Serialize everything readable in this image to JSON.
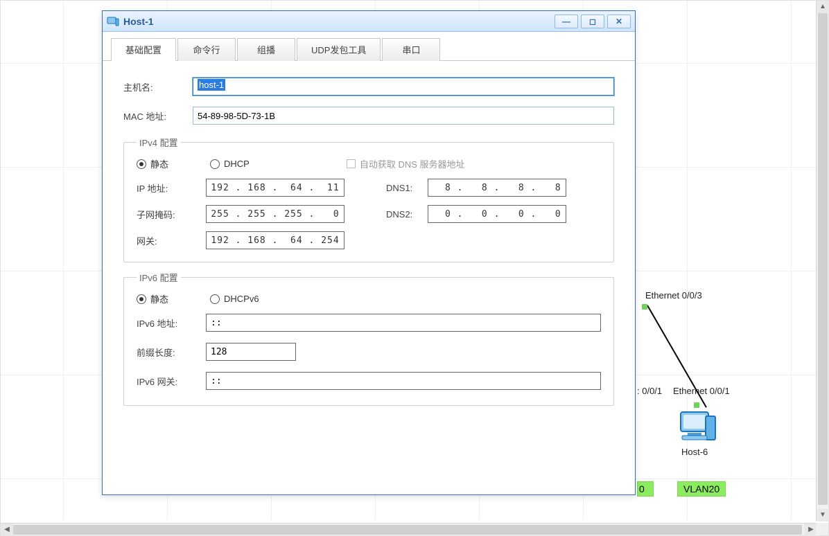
{
  "window": {
    "title": "Host-1"
  },
  "tabs": [
    {
      "label": "基础配置",
      "active": true
    },
    {
      "label": "命令行",
      "active": false
    },
    {
      "label": "组播",
      "active": false
    },
    {
      "label": "UDP发包工具",
      "active": false
    },
    {
      "label": "串口",
      "active": false
    }
  ],
  "basic": {
    "hostname_label": "主机名:",
    "hostname_value": "host-1",
    "mac_label": "MAC 地址:",
    "mac_value": "54-89-98-5D-73-1B"
  },
  "ipv4": {
    "legend": "IPv4 配置",
    "static_label": "静态",
    "dhcp_label": "DHCP",
    "auto_dns_label": "自动获取 DNS 服务器地址",
    "ip_label": "IP 地址:",
    "ip_value": "192 . 168 .  64 .  11",
    "mask_label": "子网掩码:",
    "mask_value": "255 . 255 . 255 .   0",
    "gw_label": "网关:",
    "gw_value": "192 . 168 .  64 . 254",
    "dns1_label": "DNS1:",
    "dns1_value": "  8 .   8 .   8 .   8",
    "dns2_label": "DNS2:",
    "dns2_value": "  0 .   0 .   0 .   0"
  },
  "ipv6": {
    "legend": "IPv6 配置",
    "static_label": "静态",
    "dhcpv6_label": "DHCPv6",
    "addr_label": "IPv6 地址:",
    "addr_value": "::",
    "prefix_label": "前缀长度:",
    "prefix_value": "128",
    "gw_label": "IPv6 网关:",
    "gw_value": "::"
  },
  "topology": {
    "port_a": "Ethernet 0/0/3",
    "port_b_short": ": 0/0/1",
    "port_c": "Ethernet 0/0/1",
    "host6": "Host-6",
    "vlan20": "VLAN20"
  }
}
